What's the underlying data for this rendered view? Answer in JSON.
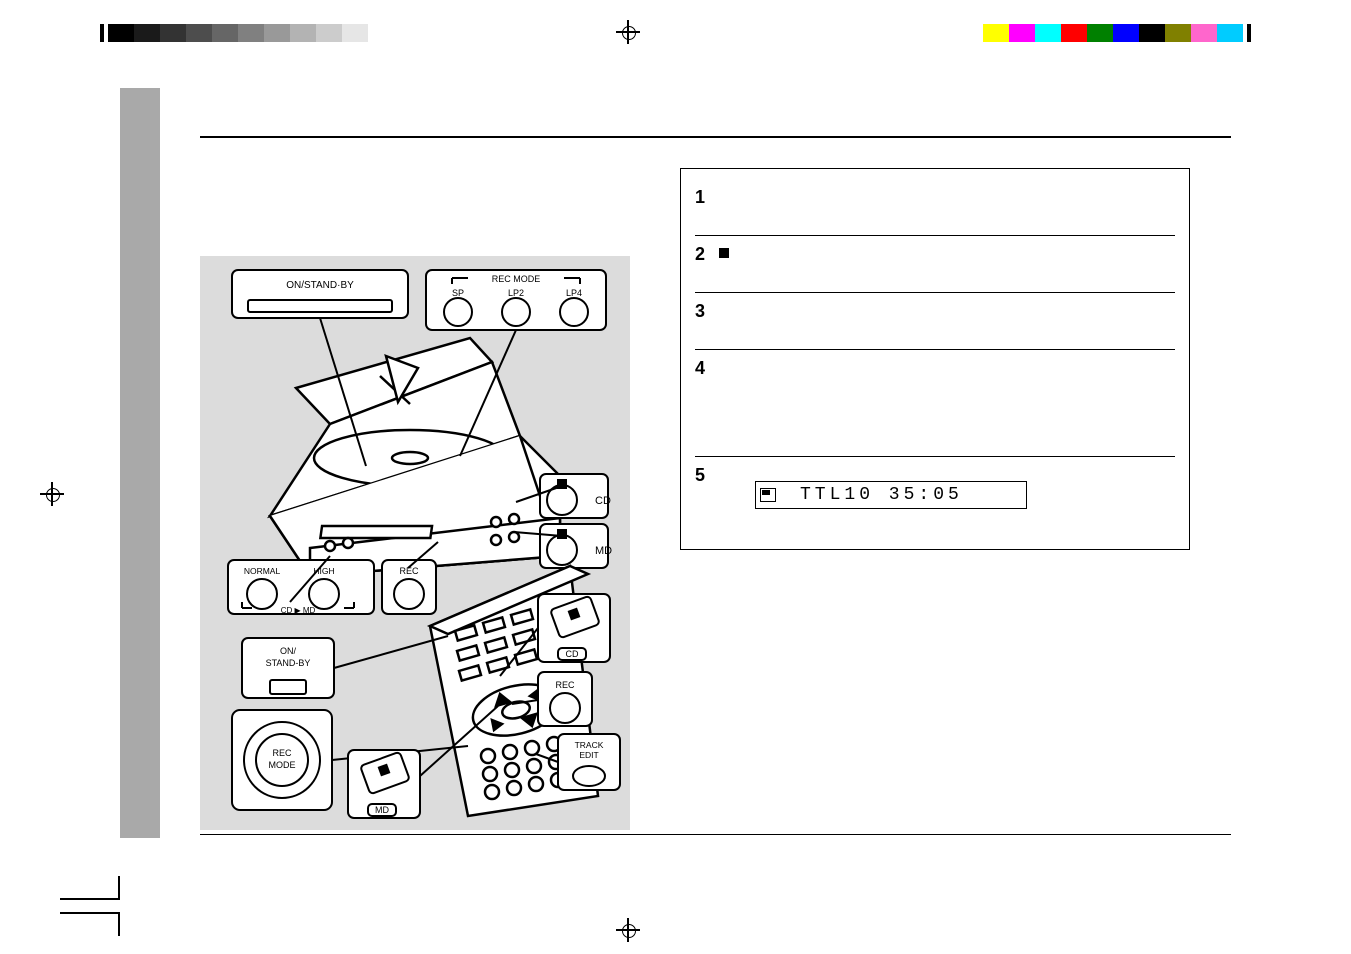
{
  "illus": {
    "on_standby": "ON/STAND·BY",
    "rec_mode_header": "REC MODE",
    "sp": "SP",
    "lp2": "LP2",
    "lp4": "LP4",
    "normal": "NORMAL",
    "high": "HIGH",
    "rec": "REC",
    "cd_to_md": "CD ▶ MD",
    "cd": "CD",
    "md": "MD",
    "remote_on_standby": "ON/\nSTAND-BY",
    "rec_mode_btn": "REC\nMODE",
    "track_edit": "TRACK\nEDIT",
    "cd_box": "CD",
    "md_box": "MD",
    "rec_box": "REC"
  },
  "steps": {
    "s1": "",
    "s2_pre": "",
    "s2_post": "",
    "s3": "",
    "s4": "",
    "s5": ""
  },
  "display": {
    "text": "TTL10 35:05"
  }
}
